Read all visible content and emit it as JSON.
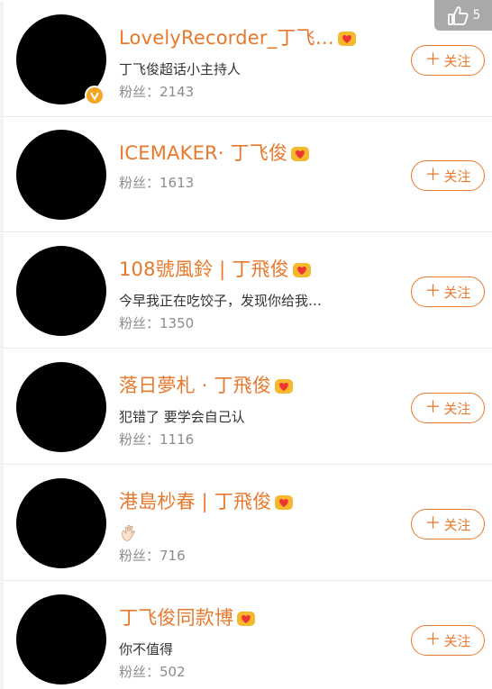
{
  "like": {
    "icon": "thumb-up-icon",
    "count": "5"
  },
  "follow_label": "关注",
  "users": [
    {
      "name": "LovelyRecorder_丁飞…",
      "desc": "丁飞俊超话小主持人",
      "fans": "粉丝：2143",
      "verified": true
    },
    {
      "name": "ICEMAKER· 丁飞俊",
      "desc": "",
      "fans": "粉丝：1613",
      "verified": false
    },
    {
      "name": "108號風鈴 | 丁飛俊",
      "desc": "今早我正在吃饺子，发现你给我…",
      "fans": "粉丝：1350",
      "verified": false
    },
    {
      "name": "落日夢札 · 丁飛俊",
      "desc": "犯错了 要学会自己认",
      "fans": "粉丝：1116",
      "verified": false
    },
    {
      "name": "港島杪春 | 丁飛俊",
      "desc": "",
      "fans": "粉丝：716",
      "verified": false
    },
    {
      "name": "丁飞俊同款博",
      "desc": "你不值得",
      "fans": "粉丝：502",
      "verified": false
    }
  ]
}
